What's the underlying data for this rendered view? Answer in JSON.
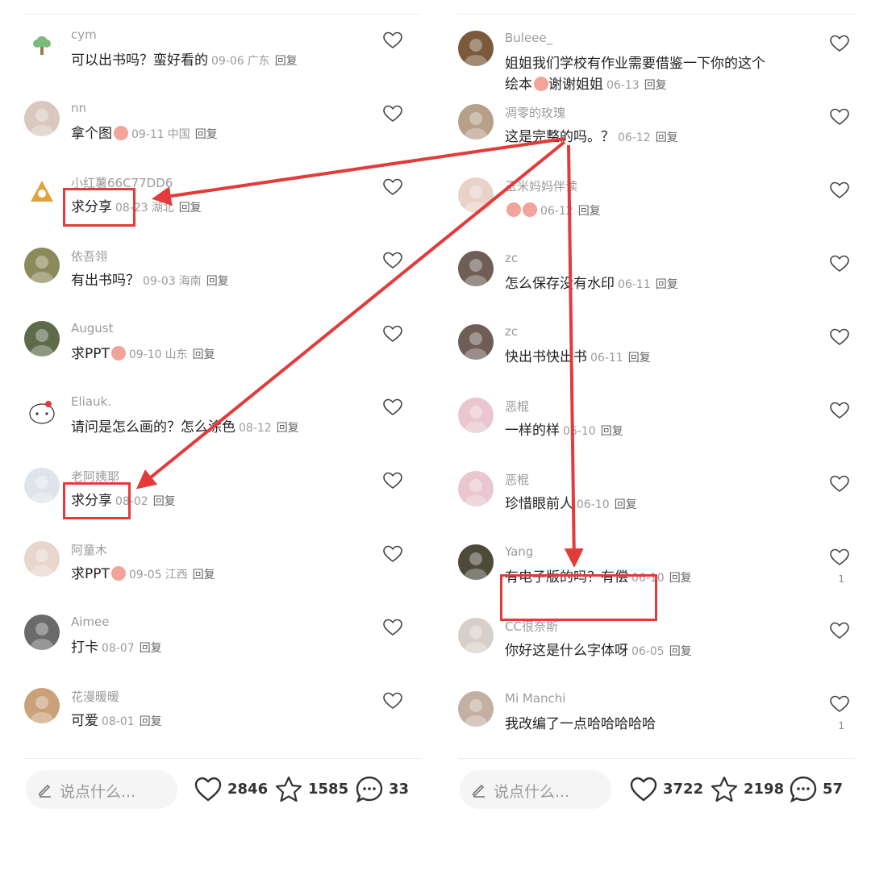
{
  "left": {
    "comments": [
      {
        "user": "cym",
        "text": "可以出书吗？蛮好看的",
        "date": "09-06",
        "location": "广东",
        "reply": "回复",
        "avatar": "cym-avatar",
        "emoji": false
      },
      {
        "user": "nn",
        "text": "拿个图",
        "date": "09-11",
        "location": "中国",
        "reply": "回复",
        "avatar": "nn-avatar",
        "emoji": true
      },
      {
        "user": "小红薯66C77DD6",
        "text": "求分享",
        "date": "08-23",
        "location": "湖北",
        "reply": "回复",
        "avatar": "xhs-avatar",
        "emoji": false
      },
      {
        "user": "依吾翎",
        "text": "有出书吗？",
        "date": "09-03",
        "location": "海南",
        "reply": "回复",
        "avatar": "yiwuling-avatar",
        "emoji": false
      },
      {
        "user": "August",
        "text": "求PPT",
        "date": "09-10",
        "location": "山东",
        "reply": "回复",
        "avatar": "august-avatar",
        "emoji": true
      },
      {
        "user": "Eliauk.",
        "text": "请问是怎么画的？怎么涂色",
        "date": "08-12",
        "location": "",
        "reply": "回复",
        "avatar": "eliauk-avatar",
        "emoji": false
      },
      {
        "user": "老阿姨耶",
        "text": "求分享",
        "date": "08-02",
        "location": "",
        "reply": "回复",
        "avatar": "laoayi-avatar",
        "emoji": false
      },
      {
        "user": "阿童木",
        "text": "求PPT",
        "date": "09-05",
        "location": "江西",
        "reply": "回复",
        "avatar": "atongmu-avatar",
        "emoji": true
      },
      {
        "user": "Aimee",
        "text": "打卡",
        "date": "08-07",
        "location": "",
        "reply": "回复",
        "avatar": "aimee-avatar",
        "emoji": false
      },
      {
        "user": "花漫暖暖",
        "text": "可爱",
        "date": "08-01",
        "location": "",
        "reply": "回复",
        "avatar": "huaman-avatar",
        "emoji": false
      }
    ],
    "bottom": {
      "placeholder": "说点什么...",
      "likes": "2846",
      "stars": "1585",
      "comments": "33"
    }
  },
  "right": {
    "comments": [
      {
        "user": "Buleee_",
        "text": "姐姐我们学校有作业需要借鉴一下你的这个绘本",
        "tail": "谢谢姐姐",
        "date": "06-13",
        "location": "",
        "reply": "回复",
        "avatar": "buleee-avatar",
        "emoji": true
      },
      {
        "user": "凋零的玫瑰",
        "text": "这是完整的吗。？",
        "date": "06-12",
        "location": "",
        "reply": "回复",
        "avatar": "rose-avatar",
        "emoji": false
      },
      {
        "user": "玉米妈妈伴读",
        "text": "",
        "date": "06-12",
        "location": "",
        "reply": "回复",
        "avatar": "yumi-avatar",
        "emoji": true,
        "emoji2": true
      },
      {
        "user": "zc",
        "text": "怎么保存没有水印",
        "date": "06-11",
        "location": "",
        "reply": "回复",
        "avatar": "zc-avatar",
        "emoji": false
      },
      {
        "user": "zc",
        "text": "快出书快出书",
        "date": "06-11",
        "location": "",
        "reply": "回复",
        "avatar": "zc-avatar",
        "emoji": false
      },
      {
        "user": "恶棍",
        "text": "一样的样",
        "date": "06-10",
        "location": "",
        "reply": "回复",
        "avatar": "egun-avatar",
        "emoji": false
      },
      {
        "user": "恶棍",
        "text": "珍惜眼前人",
        "date": "06-10",
        "location": "",
        "reply": "回复",
        "avatar": "egun-avatar",
        "emoji": false
      },
      {
        "user": "Yang",
        "text": "有电子版的吗？有偿",
        "date": "06-10",
        "location": "",
        "reply": "回复",
        "avatar": "yang-avatar",
        "emoji": false,
        "like_count": "1"
      },
      {
        "user": "CC很奈斯",
        "text": "你好这是什么字体呀",
        "date": "06-05",
        "location": "",
        "reply": "回复",
        "avatar": "cc-avatar",
        "emoji": false
      },
      {
        "user": "Mi Manchi",
        "text": "我改编了一点哈哈哈哈哈",
        "date": "",
        "location": "",
        "reply": "",
        "avatar": "mimanchi-avatar",
        "emoji": false,
        "like_count": "1"
      }
    ],
    "bottom": {
      "placeholder": "说点什么...",
      "likes": "3722",
      "stars": "2198",
      "comments": "57"
    }
  },
  "colors": {
    "annotation_red": "#e33a3a",
    "username_gray": "#9b9b9b",
    "text": "#222222"
  }
}
